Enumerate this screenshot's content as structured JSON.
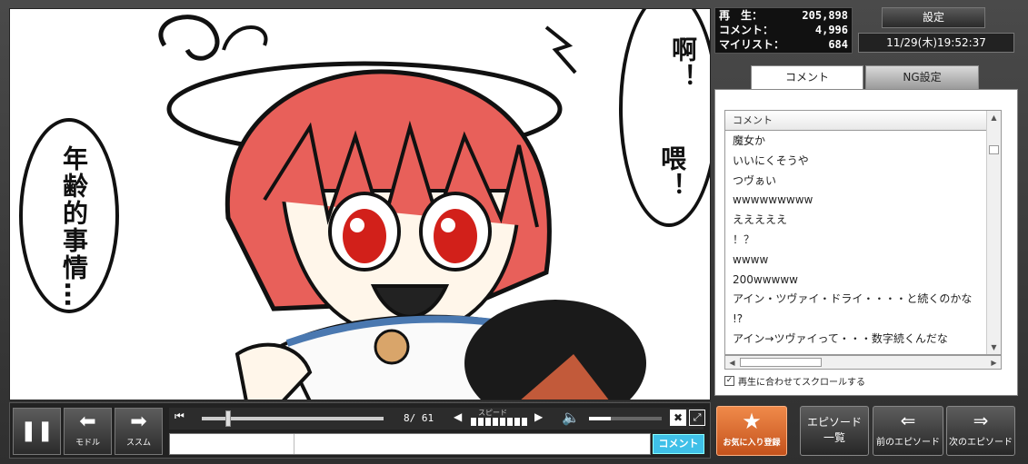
{
  "stats": {
    "views_label": "再　生：",
    "views": "205,898",
    "comments_label": "コメント：",
    "comments": "4,996",
    "mylist_label": "マイリスト：",
    "mylist": "684"
  },
  "settings_label": "設定",
  "clock": "11/29(木)19:52:37",
  "tabs": {
    "comment": "コメント",
    "ng": "NG設定"
  },
  "comment_list": {
    "header": "コメント",
    "items": [
      "魔女か",
      "いいにくそうや",
      "つヴぁい",
      "wwwwwwwww",
      "えええええ",
      "！？",
      "wwww",
      "200wwwww",
      "アイン・ツヴァイ・ドライ・・・・と続くのかな",
      "!?",
      "アイン→ツヴァイって・・・数字続くんだな"
    ]
  },
  "autoscroll_label": "再生に合わせてスクロールする",
  "video": {
    "left_bubble": "年齢的事情…",
    "right_bubble_top": "啊！",
    "right_bubble_bottom": "喂！"
  },
  "controls": {
    "back_label": "モドル",
    "forward_label": "ススム",
    "time": "8/ 61",
    "speed_label": "スピード",
    "progress": 0.13,
    "volume": 0.3,
    "comment_submit": "コメント"
  },
  "buttons": {
    "favorite": "お気に入り登録",
    "episode_list_1": "エピソード",
    "episode_list_2": "一覧",
    "prev_episode": "前のエピソード",
    "next_episode": "次のエピソード"
  },
  "colors": {
    "accent_orange": "#e06a2c",
    "comment_blue": "#3fc0e8",
    "hair_red": "#e8605a"
  }
}
